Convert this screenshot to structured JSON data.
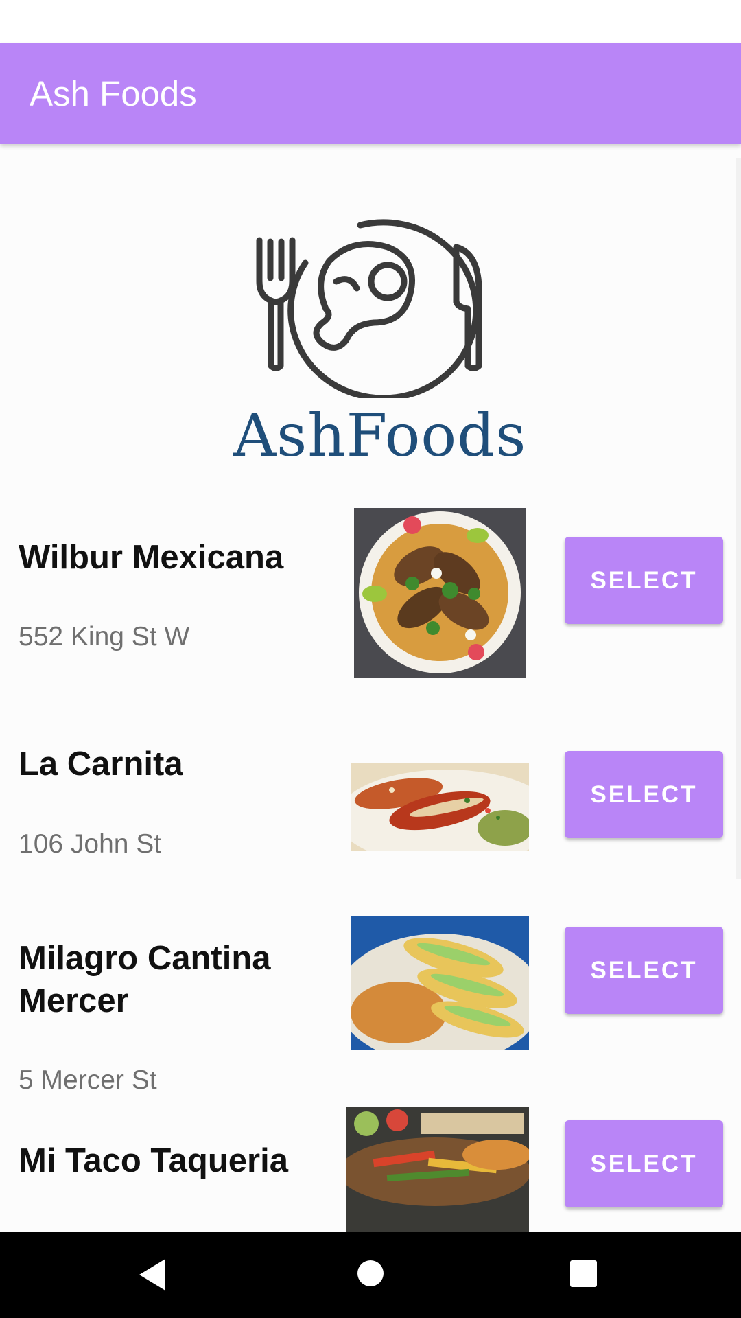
{
  "app_bar": {
    "title": "Ash Foods",
    "color": "#b985f7"
  },
  "logo": {
    "text": "AshFoods",
    "icon": "fork-plate-knife-icon"
  },
  "restaurants": [
    {
      "name": "Wilbur Mexicana",
      "address": "552 King St W",
      "button": "SELECT",
      "image": "tacos-plate-photo"
    },
    {
      "name": "La Carnita",
      "address": "106 John St",
      "button": "SELECT",
      "image": "enchiladas-photo"
    },
    {
      "name": "Milagro Cantina Mercer",
      "address": "5 Mercer St",
      "button": "SELECT",
      "image": "tacos-rice-photo"
    },
    {
      "name": "Mi Taco Taqueria",
      "address": "",
      "button": "SELECT",
      "image": "fajitas-photo"
    }
  ],
  "nav": {
    "back": "back-icon",
    "home": "home-icon",
    "recents": "recents-icon"
  }
}
